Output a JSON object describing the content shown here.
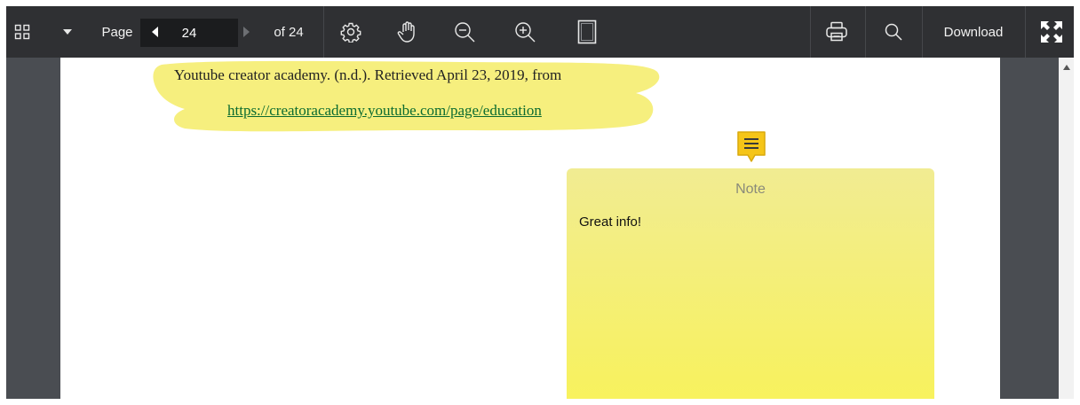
{
  "toolbar": {
    "page_label": "Page",
    "page_value": "24",
    "of_label": "of 24",
    "download_label": "Download",
    "icons": [
      "thumbnails-icon",
      "dropdown-arrow-icon",
      "prev-page-icon",
      "next-page-icon",
      "settings-icon",
      "pan-hand-icon",
      "zoom-out-icon",
      "zoom-in-icon",
      "fit-page-icon",
      "print-icon",
      "search-icon",
      "fullscreen-icon"
    ]
  },
  "document": {
    "reference_line1": "Youtube creator academy. (n.d.). Retrieved April 23, 2019, from",
    "reference_link": "https://creatoracademy.youtube.com/page/education",
    "highlight_color": "#f6ef7e"
  },
  "note": {
    "title": "Note",
    "text": "Great info!",
    "icon_color": "#f5c518"
  }
}
